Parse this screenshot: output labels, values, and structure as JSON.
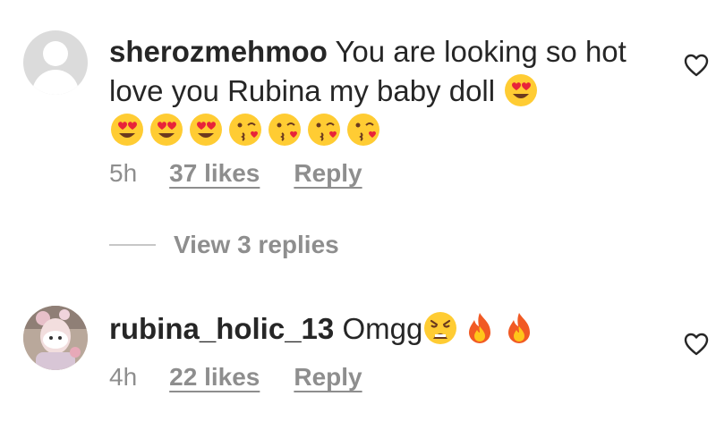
{
  "comments": [
    {
      "username": "sherozmehmoo",
      "text": "You are looking so hot love you Rubina my baby doll",
      "emojis_inline": [
        "heart-eyes"
      ],
      "emojis_line2": [
        "heart-eyes",
        "heart-eyes",
        "heart-eyes",
        "kiss-wink",
        "kiss-wink",
        "kiss-wink",
        "kiss-wink"
      ],
      "time": "5h",
      "likes": "37 likes",
      "reply": "Reply",
      "avatar_icon": "default-avatar-icon"
    },
    {
      "username": "rubina_holic_13",
      "text": "Omgg",
      "emojis_inline": [
        "weary-face",
        "fire",
        "fire"
      ],
      "time": "4h",
      "likes": "22 likes",
      "reply": "Reply",
      "avatar_icon": "profile-photo"
    }
  ],
  "view_replies": "View 3 replies",
  "icons": {
    "like": "heart-outline-icon"
  },
  "colors": {
    "text": "#262626",
    "secondary": "#8e8e8e",
    "divider": "#c7c7c7",
    "avatar_bg": "#dbdbdb"
  }
}
